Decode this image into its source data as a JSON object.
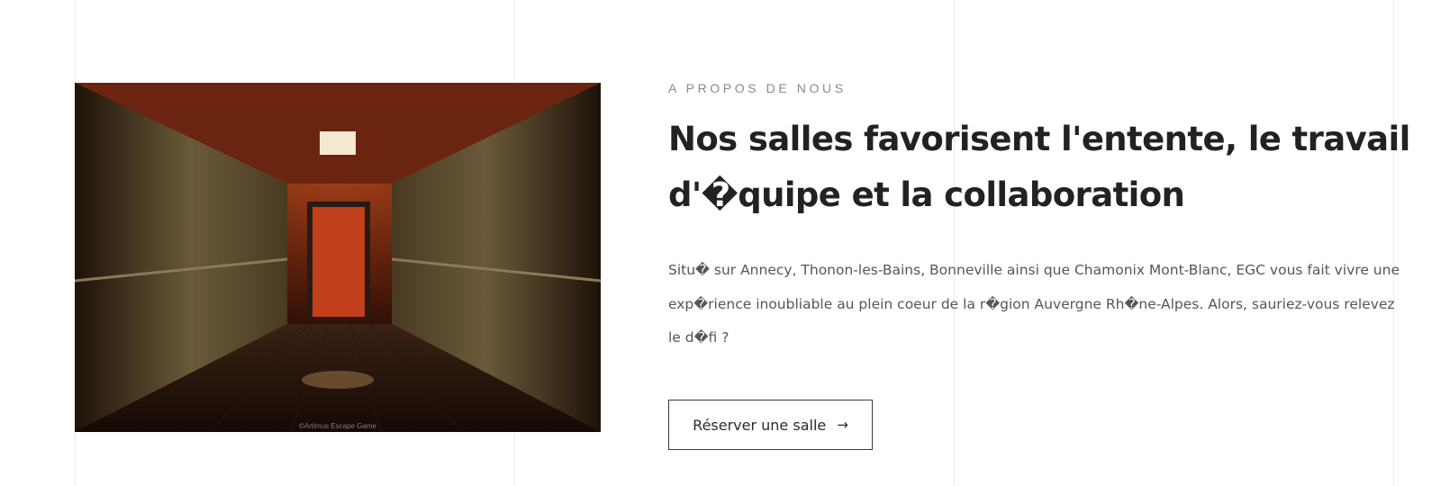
{
  "about": {
    "eyebrow": "A PROPOS DE NOUS",
    "headline": "Nos salles favorisent l'entente, le travail d'�quipe et la collaboration",
    "body": "Situ� sur Annecy, Thonon-les-Bains, Bonneville ainsi que Chamonix Mont-Blanc, EGC vous fait vivre une exp�rience inoubliable au plein coeur de la r�gion Auvergne Rh�ne-Alpes. Alors, sauriez-vous relevez le d�fi ?",
    "cta_label": "Réserver une salle",
    "cta_icon": "arrow-right-icon"
  },
  "image": {
    "credit": "©Artimus Escape Game"
  }
}
